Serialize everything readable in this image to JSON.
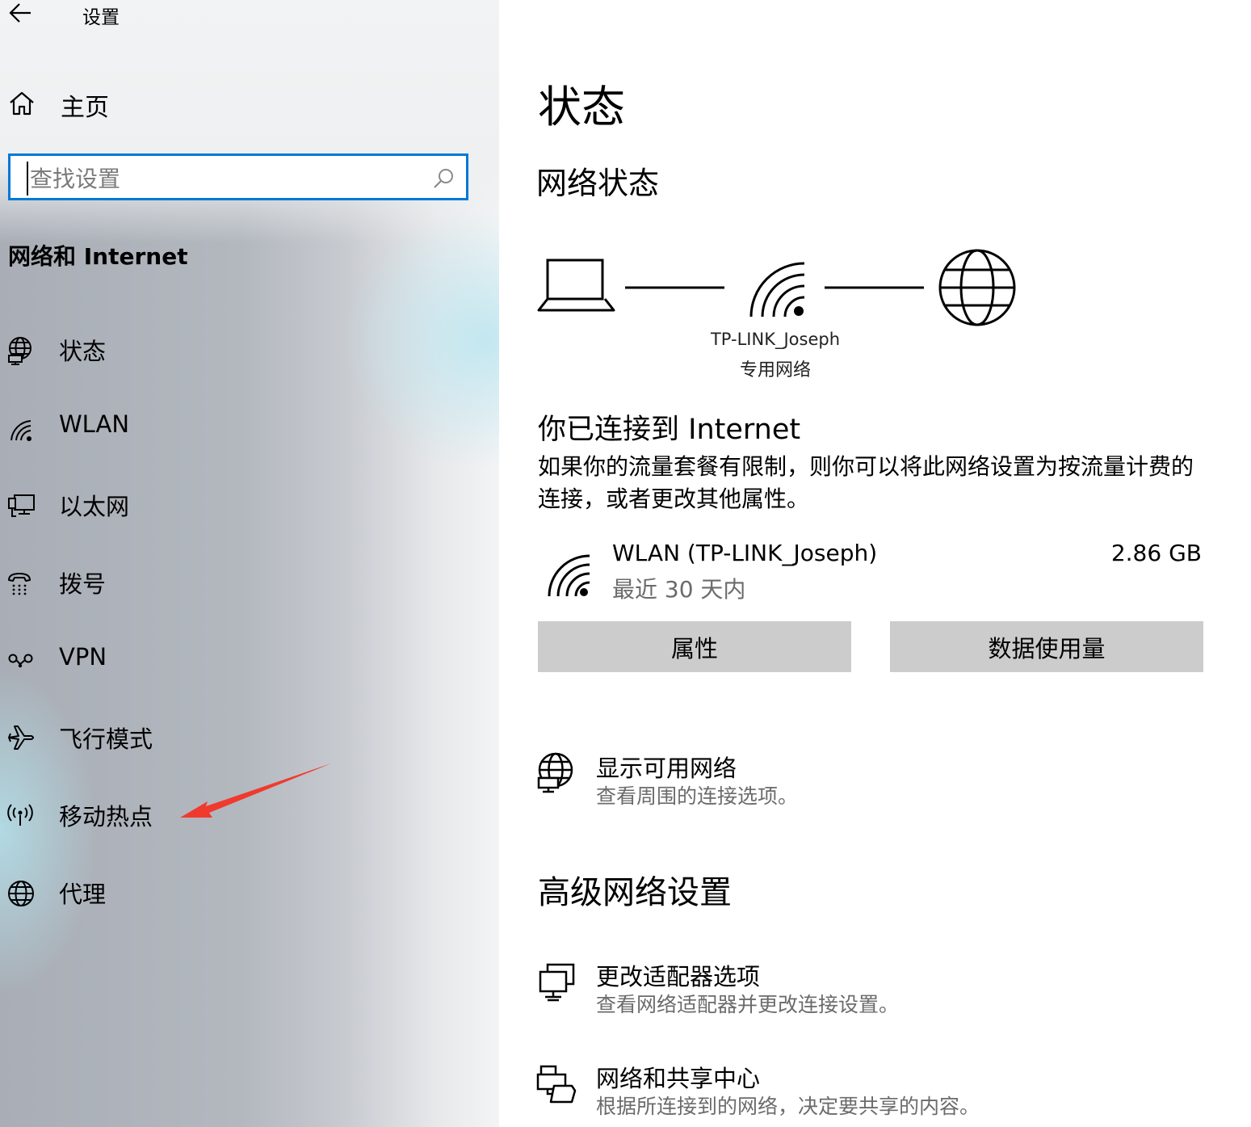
{
  "app": {
    "title": "设置"
  },
  "sidebar": {
    "home_label": "主页",
    "search": {
      "placeholder": "查找设置"
    },
    "section_title": "网络和 Internet",
    "items": [
      {
        "label": "状态",
        "icon": "network-status-icon"
      },
      {
        "label": "WLAN",
        "icon": "wifi-icon"
      },
      {
        "label": "以太网",
        "icon": "ethernet-icon"
      },
      {
        "label": "拨号",
        "icon": "dial-up-icon"
      },
      {
        "label": "VPN",
        "icon": "vpn-icon"
      },
      {
        "label": "飞行模式",
        "icon": "airplane-icon"
      },
      {
        "label": "移动热点",
        "icon": "hotspot-icon"
      },
      {
        "label": "代理",
        "icon": "globe-icon"
      }
    ],
    "annotation_arrow_color": "#f03a2e"
  },
  "main": {
    "title": "状态",
    "network_status_heading": "网络状态",
    "network": {
      "name": "TP-LINK_Joseph",
      "type": "专用网络"
    },
    "connected_title": "你已连接到 Internet",
    "connected_desc": "如果你的流量套餐有限制，则你可以将此网络设置为按流量计费的连接，或者更改其他属性。",
    "connection": {
      "name": "WLAN (TP-LINK_Joseph)",
      "period": "最近 30 天内",
      "usage": "2.86 GB"
    },
    "buttons": {
      "properties": "属性",
      "data_usage": "数据使用量"
    },
    "show_networks": {
      "title": "显示可用网络",
      "desc": "查看周围的连接选项。"
    },
    "advanced_heading": "高级网络设置",
    "adapter_options": {
      "title": "更改适配器选项",
      "desc": "查看网络适配器并更改连接设置。"
    },
    "sharing_center": {
      "title": "网络和共享中心",
      "desc": "根据所连接到的网络，决定要共享的内容。"
    }
  },
  "colors": {
    "accent": "#0078d7",
    "button_bg": "#cccccc",
    "secondary_text": "#6b6b6b"
  }
}
